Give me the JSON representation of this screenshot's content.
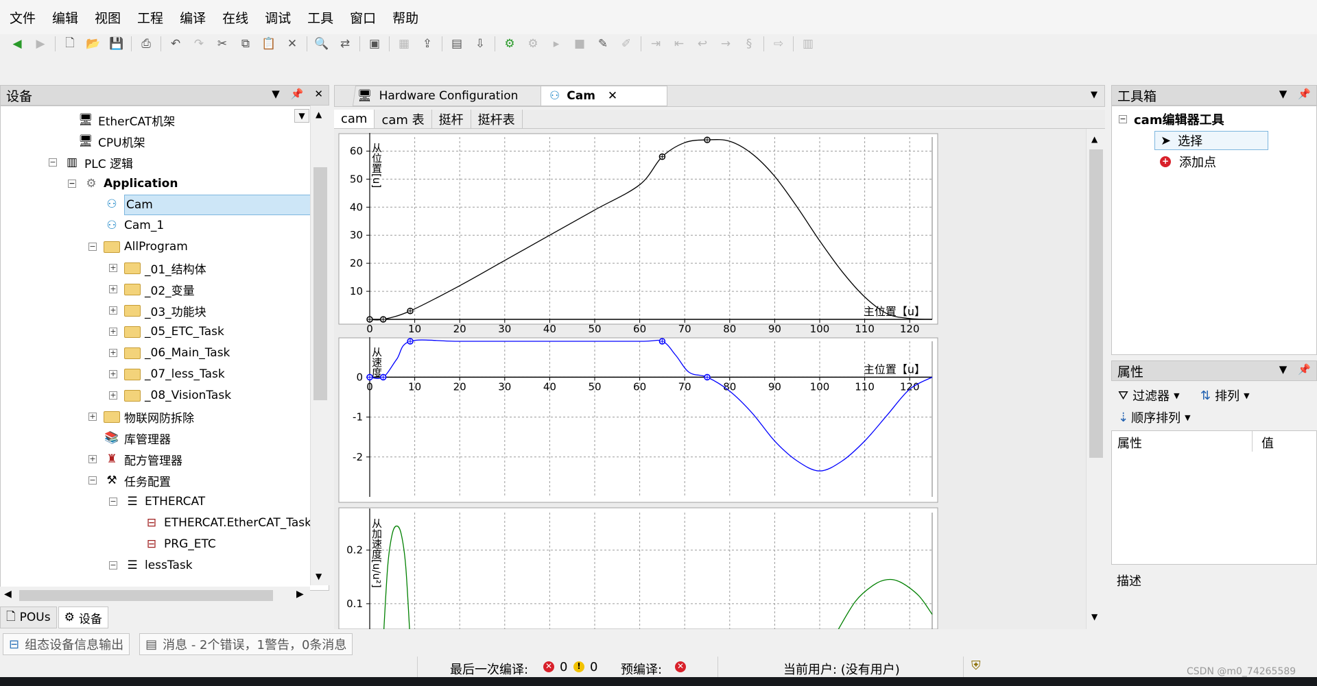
{
  "menu": [
    "文件",
    "编辑",
    "视图",
    "工程",
    "编译",
    "在线",
    "调试",
    "工具",
    "窗口",
    "帮助"
  ],
  "device_panel": {
    "title": "设备",
    "tree": [
      {
        "label": "EtherCAT机架",
        "icon": "rack-icon"
      },
      {
        "label": "CPU机架",
        "icon": "rack-icon"
      },
      {
        "label": "PLC 逻辑",
        "icon": "plc-logic-icon"
      },
      {
        "label": "Application",
        "icon": "gear-icon",
        "bold": true
      },
      {
        "label": "Cam",
        "icon": "cam-icon",
        "selected": true
      },
      {
        "label": "Cam_1",
        "icon": "cam-icon"
      },
      {
        "label": "AllProgram",
        "icon": "folder-icon"
      },
      {
        "label": "_01_结构体",
        "icon": "folder-icon"
      },
      {
        "label": "_02_变量",
        "icon": "folder-icon"
      },
      {
        "label": "_03_功能块",
        "icon": "folder-icon"
      },
      {
        "label": "_05_ETC_Task",
        "icon": "folder-icon"
      },
      {
        "label": "_06_Main_Task",
        "icon": "folder-icon"
      },
      {
        "label": "_07_less_Task",
        "icon": "folder-icon"
      },
      {
        "label": "_08_VisionTask",
        "icon": "folder-icon"
      },
      {
        "label": "物联网防拆除",
        "icon": "folder-icon"
      },
      {
        "label": "库管理器",
        "icon": "library-icon"
      },
      {
        "label": "配方管理器",
        "icon": "recipe-icon"
      },
      {
        "label": "任务配置",
        "icon": "task-config-icon"
      },
      {
        "label": "ETHERCAT",
        "icon": "task-icon"
      },
      {
        "label": "ETHERCAT.EtherCAT_Task",
        "icon": "program-call-icon"
      },
      {
        "label": "PRG_ETC",
        "icon": "program-call-icon"
      },
      {
        "label": "lessTask",
        "icon": "task-icon"
      }
    ]
  },
  "bottom_tabs": [
    "POUs",
    "设备"
  ],
  "editor": {
    "tabs": [
      {
        "label": "Hardware Configuration",
        "active": false
      },
      {
        "label": "Cam",
        "active": true
      }
    ],
    "subtabs": [
      "cam",
      "cam 表",
      "挺杆",
      "挺杆表"
    ]
  },
  "charts": {
    "position": {
      "ylabel": "从位置[u]",
      "xlabel": "主位置【u】",
      "xticks": [
        "0",
        "10",
        "20",
        "30",
        "40",
        "50",
        "60",
        "70",
        "80",
        "90",
        "100",
        "110",
        "120"
      ],
      "yticks": [
        "10",
        "20",
        "30",
        "40",
        "50",
        "60"
      ]
    },
    "velocity": {
      "ylabel": "从速度",
      "xlabel": "主位置【u】",
      "yticks": [
        "0",
        "-1",
        "-2"
      ]
    },
    "acceleration": {
      "ylabel": "从加速度[u/u²]",
      "yticks": [
        "0.1",
        "0.2"
      ]
    }
  },
  "chart_data": [
    {
      "type": "line",
      "ylabel": "从位置[u]",
      "xlabel": "主位置【u】",
      "xlim": [
        0,
        125
      ],
      "ylim": [
        0,
        65
      ],
      "series": [
        {
          "color": "#000000",
          "x": [
            0,
            3,
            9,
            20,
            30,
            40,
            50,
            60,
            65,
            70,
            75,
            80,
            85,
            90,
            95,
            100,
            105,
            110,
            115,
            120,
            125
          ],
          "y": [
            0,
            0,
            3,
            12,
            21,
            30,
            39,
            48,
            58,
            63,
            64,
            63.5,
            59,
            51,
            40,
            28,
            17,
            8,
            2,
            0.3,
            0
          ]
        }
      ],
      "control_points": [
        [
          0,
          0
        ],
        [
          3,
          0
        ],
        [
          9,
          3
        ],
        [
          65,
          58
        ],
        [
          75,
          64
        ]
      ]
    },
    {
      "type": "line",
      "ylabel": "从速度",
      "xlabel": "主位置【u】",
      "xlim": [
        0,
        125
      ],
      "ylim": [
        -3,
        0.9
      ],
      "series": [
        {
          "color": "#0000ff",
          "x": [
            0,
            3,
            6,
            9,
            20,
            40,
            60,
            65,
            68,
            71,
            75,
            80,
            85,
            90,
            95,
            100,
            105,
            110,
            115,
            120,
            125
          ],
          "y": [
            0,
            0,
            0.45,
            0.9,
            0.9,
            0.9,
            0.9,
            0.9,
            0.55,
            0.12,
            0,
            -0.35,
            -0.9,
            -1.6,
            -2.1,
            -2.35,
            -2.1,
            -1.6,
            -0.95,
            -0.3,
            0
          ]
        }
      ],
      "control_points": [
        [
          0,
          0
        ],
        [
          3,
          0
        ],
        [
          9,
          0.9
        ],
        [
          65,
          0.9
        ],
        [
          75,
          0
        ]
      ]
    },
    {
      "type": "line",
      "ylabel": "从加速度[u/u²]",
      "xlim": [
        0,
        125
      ],
      "ylim": [
        0.05,
        0.27
      ],
      "series": [
        {
          "color": "#008000",
          "x": [
            3,
            4,
            5,
            6,
            7,
            8,
            9
          ],
          "y": [
            0.03,
            0.17,
            0.23,
            0.245,
            0.23,
            0.17,
            0.03
          ]
        },
        {
          "color": "#008000",
          "x": [
            104,
            108,
            112,
            115,
            118,
            122,
            125
          ],
          "y": [
            0.05,
            0.105,
            0.135,
            0.145,
            0.14,
            0.115,
            0.08
          ]
        }
      ]
    }
  ],
  "toolbox": {
    "title": "工具箱",
    "group": "cam编辑器工具",
    "items": [
      {
        "label": "选择",
        "icon": "cursor-icon"
      },
      {
        "label": "添加点",
        "icon": "add-point-icon"
      }
    ]
  },
  "properties": {
    "title": "属性",
    "filter": "过滤器",
    "sort": "排列",
    "order": "顺序排列",
    "col_name": "属性",
    "col_value": "值"
  },
  "description": {
    "label": "描述"
  },
  "messages": {
    "device_output": "组态设备信息输出",
    "messages": "消息 - 2个错误，1警告，0条消息"
  },
  "status": {
    "last_compile": "最后一次编译:",
    "errors": "0",
    "warnings": "0",
    "precompile": "预编译:",
    "current_user": "当前用户: (没有用户)",
    "watermark": "CSDN @m0_74265589"
  }
}
